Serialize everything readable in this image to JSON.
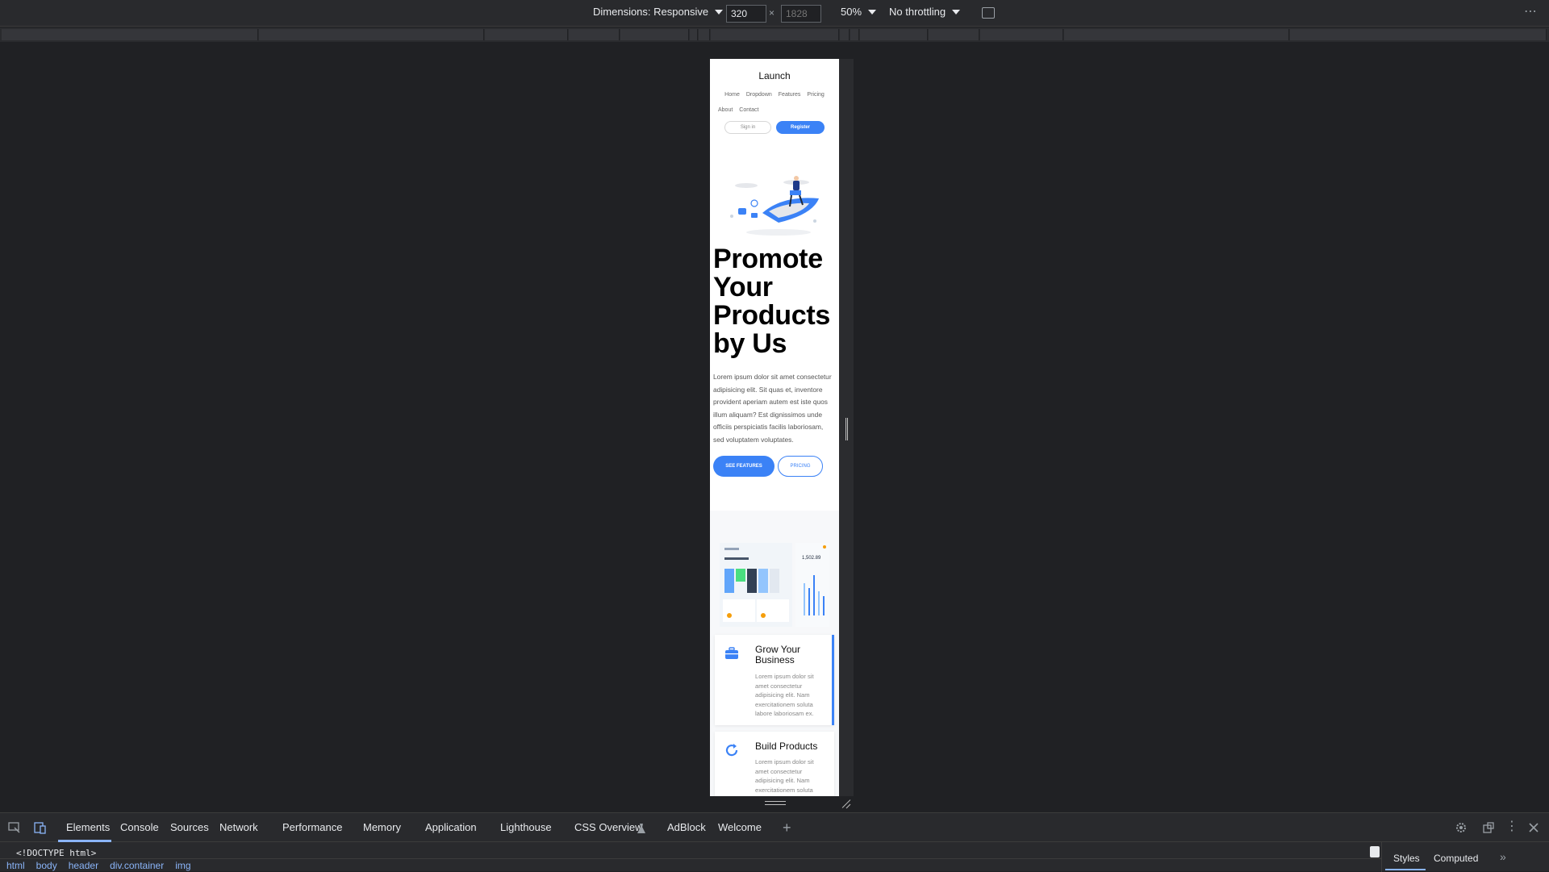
{
  "toolbar": {
    "dimensions_label": "Dimensions: Responsive",
    "width_value": "320",
    "height_placeholder": "1828",
    "times": "×",
    "zoom": "50%",
    "throttling": "No throttling"
  },
  "page": {
    "brand": "Launch",
    "nav_row1": [
      "Home",
      "Dropdown",
      "Features",
      "Pricing"
    ],
    "nav_row2": [
      "About",
      "Contact"
    ],
    "signin_label": "Sign in",
    "register_label": "Register",
    "headline": "Promote Your Products by Us",
    "body": "Lorem ipsum dolor sit amet consectetur adipisicing elit. Sit quas et, inventore provident aperiam autem est iste quos illum aliquam? Est dignissimos unde officiis perspiciatis facilis laboriosam, sed voluptatem voluptates.",
    "see_features_label": "SEE FEATURES",
    "pricing_label": "PRICING",
    "dashboard_value": "1,502.89",
    "cards": [
      {
        "title": "Grow Your Business",
        "text": "Lorem ipsum dolor sit amet consectetur adipisicing elit. Nam exercitationem soluta labore laboriosam ex."
      },
      {
        "title": "Build Products",
        "text": "Lorem ipsum dolor sit amet consectetur adipisicing elit. Nam exercitationem soluta"
      }
    ],
    "accent_color": "#3b82f6"
  },
  "devtools": {
    "tabs": [
      "Elements",
      "Console",
      "Sources",
      "Network",
      "Performance",
      "Memory",
      "Application",
      "Lighthouse",
      "CSS Overview",
      "AdBlock",
      "Welcome"
    ],
    "doctype": "<!DOCTYPE html>",
    "breadcrumbs": [
      "html",
      "body",
      "header",
      "div.container",
      "img"
    ],
    "styles_tabs": [
      "Styles",
      "Computed"
    ]
  }
}
